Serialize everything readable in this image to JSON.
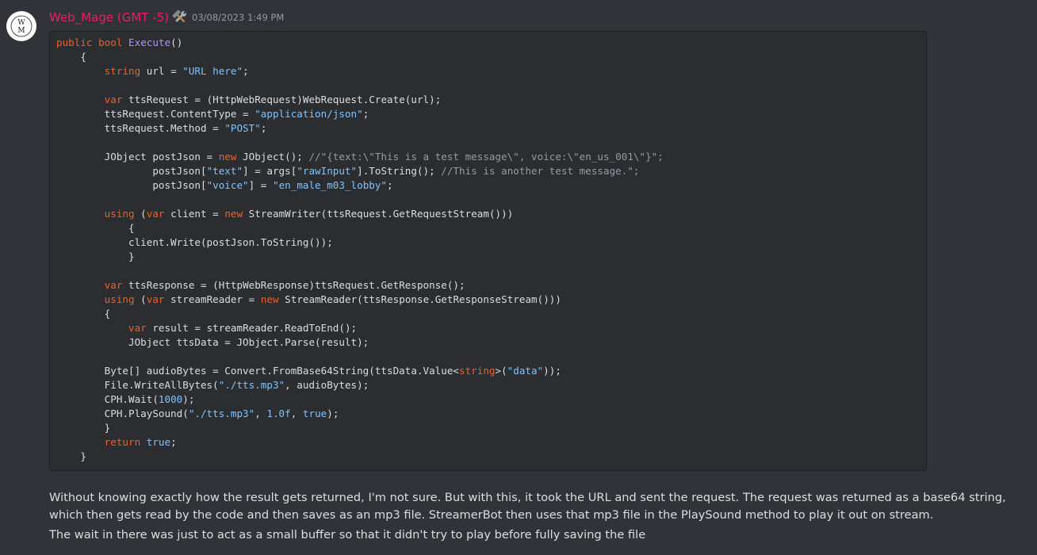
{
  "message": {
    "author": "Web_Mage (GMT -5)",
    "author_color": "#e91e63",
    "role_icon": "hammer-wrench-icon",
    "timestamp": "03/08/2023 1:49 PM",
    "avatar_text": "W\nM"
  },
  "code": {
    "language": "csharp",
    "lines": [
      [
        {
          "t": "kw",
          "v": "public"
        },
        {
          "t": "plain",
          "v": " "
        },
        {
          "t": "kw",
          "v": "bool"
        },
        {
          "t": "plain",
          "v": " "
        },
        {
          "t": "fn",
          "v": "Execute"
        },
        {
          "t": "plain",
          "v": "()"
        }
      ],
      [
        {
          "t": "plain",
          "v": "    {"
        }
      ],
      [
        {
          "t": "plain",
          "v": "        "
        },
        {
          "t": "kw",
          "v": "string"
        },
        {
          "t": "plain",
          "v": " url = "
        },
        {
          "t": "str",
          "v": "\"URL here\""
        },
        {
          "t": "plain",
          "v": ";"
        }
      ],
      [],
      [
        {
          "t": "plain",
          "v": "        "
        },
        {
          "t": "kw",
          "v": "var"
        },
        {
          "t": "plain",
          "v": " ttsRequest = (HttpWebRequest)WebRequest.Create(url);"
        }
      ],
      [
        {
          "t": "plain",
          "v": "        ttsRequest.ContentType = "
        },
        {
          "t": "str",
          "v": "\"application/json\""
        },
        {
          "t": "plain",
          "v": ";"
        }
      ],
      [
        {
          "t": "plain",
          "v": "        ttsRequest.Method = "
        },
        {
          "t": "str",
          "v": "\"POST\""
        },
        {
          "t": "plain",
          "v": ";"
        }
      ],
      [],
      [
        {
          "t": "plain",
          "v": "        JObject postJson = "
        },
        {
          "t": "kw",
          "v": "new"
        },
        {
          "t": "plain",
          "v": " JObject(); "
        },
        {
          "t": "cmt",
          "v": "//\"{text:\\\"This is a test message\\\", voice:\\\"en_us_001\\\"}\";"
        }
      ],
      [
        {
          "t": "plain",
          "v": "                postJson["
        },
        {
          "t": "str",
          "v": "\"text\""
        },
        {
          "t": "plain",
          "v": "] = args["
        },
        {
          "t": "str",
          "v": "\"rawInput\""
        },
        {
          "t": "plain",
          "v": "].ToString(); "
        },
        {
          "t": "cmt",
          "v": "//This is another test message.\";"
        }
      ],
      [
        {
          "t": "plain",
          "v": "                postJson["
        },
        {
          "t": "str",
          "v": "\"voice\""
        },
        {
          "t": "plain",
          "v": "] = "
        },
        {
          "t": "str",
          "v": "\"en_male_m03_lobby\""
        },
        {
          "t": "plain",
          "v": ";"
        }
      ],
      [],
      [
        {
          "t": "plain",
          "v": "        "
        },
        {
          "t": "kw",
          "v": "using"
        },
        {
          "t": "plain",
          "v": " ("
        },
        {
          "t": "kw",
          "v": "var"
        },
        {
          "t": "plain",
          "v": " client = "
        },
        {
          "t": "kw",
          "v": "new"
        },
        {
          "t": "plain",
          "v": " StreamWriter(ttsRequest.GetRequestStream()))"
        }
      ],
      [
        {
          "t": "plain",
          "v": "            {"
        }
      ],
      [
        {
          "t": "plain",
          "v": "            client.Write(postJson.ToString());"
        }
      ],
      [
        {
          "t": "plain",
          "v": "            }"
        }
      ],
      [],
      [
        {
          "t": "plain",
          "v": "        "
        },
        {
          "t": "kw",
          "v": "var"
        },
        {
          "t": "plain",
          "v": " ttsResponse = (HttpWebResponse)ttsRequest.GetResponse();"
        }
      ],
      [
        {
          "t": "plain",
          "v": "        "
        },
        {
          "t": "kw",
          "v": "using"
        },
        {
          "t": "plain",
          "v": " ("
        },
        {
          "t": "kw",
          "v": "var"
        },
        {
          "t": "plain",
          "v": " streamReader = "
        },
        {
          "t": "kw",
          "v": "new"
        },
        {
          "t": "plain",
          "v": " StreamReader(ttsResponse.GetResponseStream()))"
        }
      ],
      [
        {
          "t": "plain",
          "v": "        {"
        }
      ],
      [
        {
          "t": "plain",
          "v": "            "
        },
        {
          "t": "kw",
          "v": "var"
        },
        {
          "t": "plain",
          "v": " result = streamReader.ReadToEnd();"
        }
      ],
      [
        {
          "t": "plain",
          "v": "            JObject ttsData = JObject.Parse(result);"
        }
      ],
      [],
      [
        {
          "t": "plain",
          "v": "        Byte[] audioBytes = Convert.FromBase64String(ttsData.Value<"
        },
        {
          "t": "kw",
          "v": "string"
        },
        {
          "t": "plain",
          "v": ">("
        },
        {
          "t": "str",
          "v": "\"data\""
        },
        {
          "t": "plain",
          "v": "));"
        }
      ],
      [
        {
          "t": "plain",
          "v": "        File.WriteAllBytes("
        },
        {
          "t": "str",
          "v": "\"./tts.mp3\""
        },
        {
          "t": "plain",
          "v": ", audioBytes);"
        }
      ],
      [
        {
          "t": "plain",
          "v": "        CPH.Wait("
        },
        {
          "t": "num",
          "v": "1000"
        },
        {
          "t": "plain",
          "v": ");"
        }
      ],
      [
        {
          "t": "plain",
          "v": "        CPH.PlaySound("
        },
        {
          "t": "str",
          "v": "\"./tts.mp3\""
        },
        {
          "t": "plain",
          "v": ", "
        },
        {
          "t": "num",
          "v": "1.0f"
        },
        {
          "t": "plain",
          "v": ", "
        },
        {
          "t": "num",
          "v": "true"
        },
        {
          "t": "plain",
          "v": ");"
        }
      ],
      [
        {
          "t": "plain",
          "v": "        }"
        }
      ],
      [
        {
          "t": "plain",
          "v": "        "
        },
        {
          "t": "kw",
          "v": "return"
        },
        {
          "t": "plain",
          "v": " "
        },
        {
          "t": "num",
          "v": "true"
        },
        {
          "t": "plain",
          "v": ";"
        }
      ],
      [
        {
          "t": "plain",
          "v": "    }"
        }
      ]
    ]
  },
  "text": {
    "paragraph1": "Without knowing exactly how the result gets returned, I'm not sure. But with this, it took the URL and sent the request. The request was returned as a base64 string, which then gets read by the code and then saves as an mp3 file. StreamerBot then uses that mp3 file in the PlaySound method to play it out on stream.",
    "paragraph2": "The wait in there was just to act as a small buffer so that it didn't try to play before fully saving the file"
  }
}
